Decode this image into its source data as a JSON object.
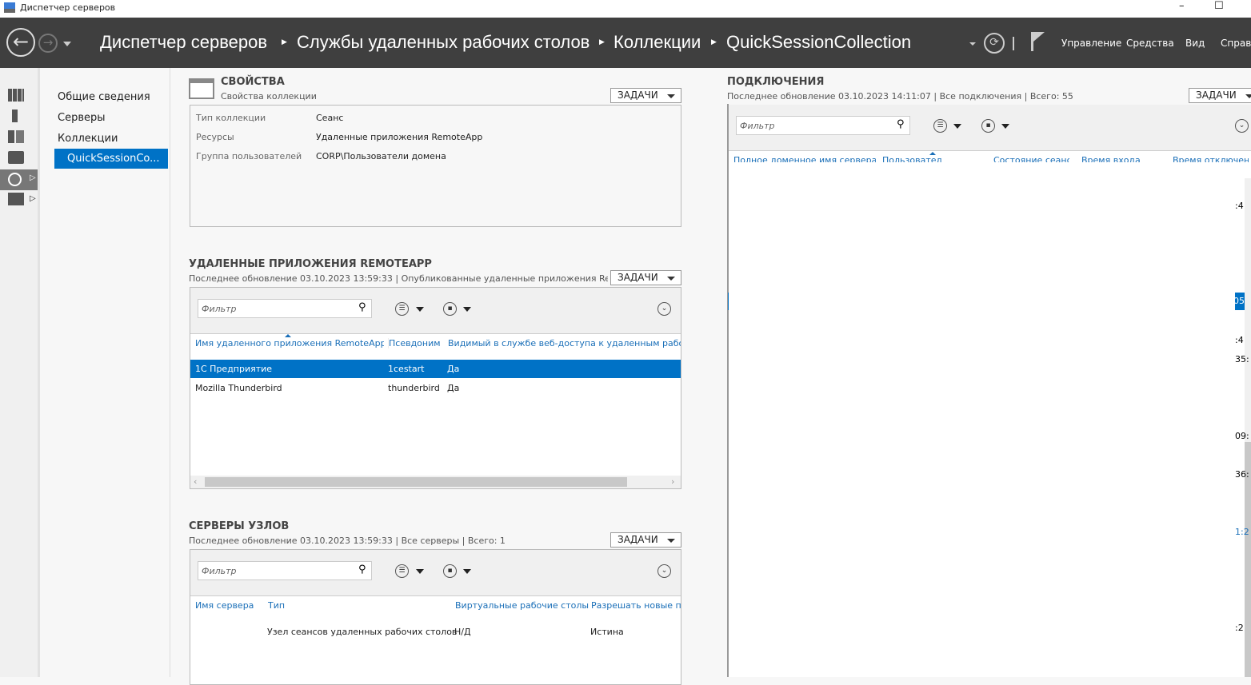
{
  "window": {
    "title": "Диспетчер серверов",
    "minimize": "–",
    "maximize": "☐"
  },
  "header": {
    "breadcrumbs": [
      "Диспетчер серверов",
      "Службы удаленных рабочих столов",
      "Коллекции",
      "QuickSessionCollection"
    ],
    "menu": [
      "Управление",
      "Средства",
      "Вид",
      "Справка"
    ]
  },
  "nav": {
    "items": [
      "Общие сведения",
      "Серверы",
      "Коллекции",
      "QuickSessionCo..."
    ]
  },
  "properties": {
    "title": "СВОЙСТВА",
    "subtitle": "Свойства коллекции",
    "tasks": "ЗАДАЧИ",
    "rows": [
      {
        "label": "Тип коллекции",
        "value": "Сеанс"
      },
      {
        "label": "Ресурсы",
        "value": "Удаленные приложения RemoteApp"
      },
      {
        "label": "Группа пользователей",
        "value": "CORP\\Пользователи домена"
      }
    ]
  },
  "remoteapp": {
    "title": "УДАЛЕННЫЕ ПРИЛОЖЕНИЯ REMOTEAPP",
    "subtitle": "Последнее обновление 03.10.2023 13:59:33 | Опубликованные удаленные приложения Remo...",
    "tasks": "ЗАДАЧИ",
    "filter_placeholder": "Фильтр",
    "columns": [
      "Имя удаленного приложения RemoteApp",
      "Псевдоним",
      "Видимый в службе веб-доступа к удаленным рабочим столам"
    ],
    "rows": [
      [
        "1С Предприятие",
        "1cestart",
        "Да"
      ],
      [
        "Mozilla Thunderbird",
        "thunderbird",
        "Да"
      ]
    ]
  },
  "hosts": {
    "title": "СЕРВЕРЫ УЗЛОВ",
    "subtitle": "Последнее обновление 03.10.2023 13:59:33 | Все серверы  | Всего: 1",
    "tasks": "ЗАДАЧИ",
    "filter_placeholder": "Фильтр",
    "columns": [
      "Имя сервера",
      "Тип",
      "Виртуальные рабочие столы",
      "Разрешать новые подключения"
    ],
    "rows": [
      [
        "",
        "Узел сеансов удаленных рабочих столов",
        "Н/Д",
        "Истина"
      ]
    ]
  },
  "connections": {
    "title": "ПОДКЛЮЧЕНИЯ",
    "subtitle": "Последнее обновление 03.10.2023 14:11:07 | Все подключения  | Всего: 55",
    "tasks": "ЗАДАЧИ",
    "filter_placeholder": "Фильтр",
    "columns": [
      "Полное доменное имя сервера",
      "Пользователь",
      "Состояние сеанса",
      "Время входа",
      "Время отключения"
    ],
    "fragments": [
      ":4",
      "05:",
      ":4",
      "35:",
      "09:",
      "36:",
      "1:2",
      ":2"
    ]
  },
  "colors": {
    "accent": "#0072c6",
    "header": "#3f3f3f",
    "link": "#1a6fb8"
  }
}
